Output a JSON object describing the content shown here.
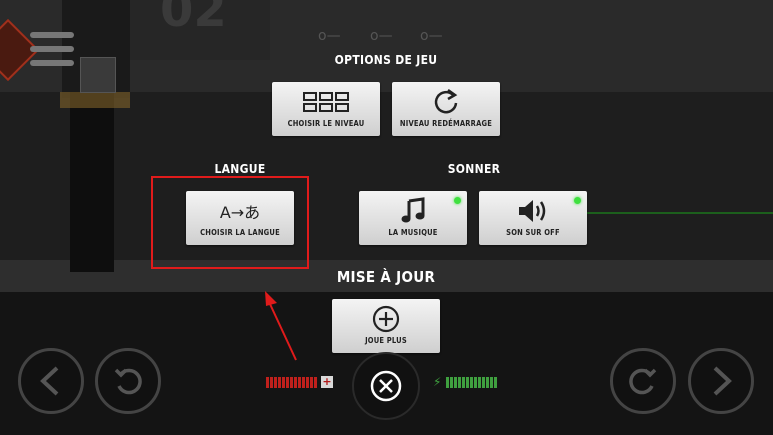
{
  "game_options": {
    "title": "OPTIONS DE JEU",
    "buttons": [
      {
        "icon": "grid-icon",
        "label": "CHOISIR LE NIVEAU"
      },
      {
        "icon": "restart-icon",
        "label": "NIVEAU REDÉMARRAGE"
      }
    ]
  },
  "language": {
    "title": "LANGUE",
    "button": {
      "icon": "translate-icon",
      "glyph": "A→あ",
      "label": "CHOISIR LA LANGUE"
    }
  },
  "sound": {
    "title": "SONNER",
    "buttons": [
      {
        "icon": "music-note-icon",
        "label": "LA MUSIQUE",
        "status": "on",
        "status_color": "#3fe03f"
      },
      {
        "icon": "speaker-icon",
        "label": "SON SUR OFF",
        "status": "on",
        "status_color": "#3fe03f"
      }
    ]
  },
  "update": {
    "title": "MISE À JOUR",
    "button": {
      "icon": "plus-circle-icon",
      "label": "JOUE PLUS"
    }
  },
  "controls": {
    "left": [
      "left-arrow-icon",
      "undo-icon"
    ],
    "right": [
      "redo-icon",
      "right-arrow-icon"
    ],
    "center": "close-icon"
  },
  "colors": {
    "highlight": "#e01b1b",
    "health": "#c0201c",
    "energy": "#3fa03f"
  }
}
